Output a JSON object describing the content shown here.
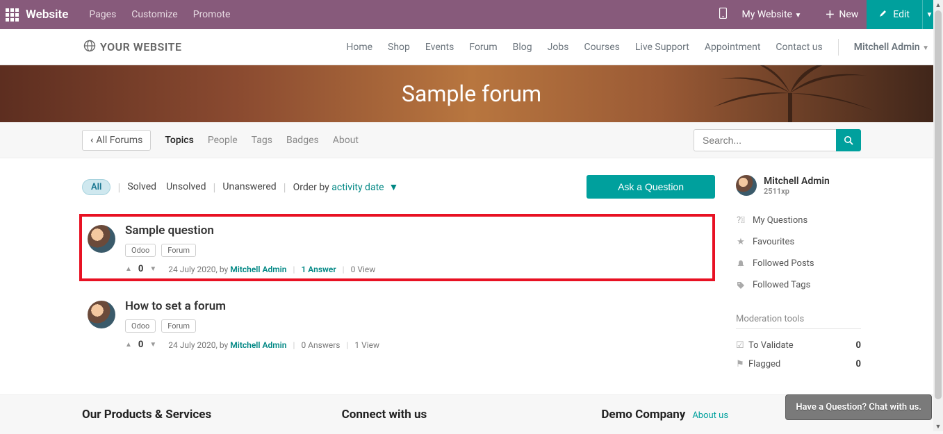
{
  "topbar": {
    "brand": "Website",
    "menu": [
      "Pages",
      "Customize",
      "Promote"
    ],
    "my_website": "My Website",
    "new": "New",
    "edit": "Edit"
  },
  "site": {
    "logo": "YOUR WEBSITE",
    "nav": [
      "Home",
      "Shop",
      "Events",
      "Forum",
      "Blog",
      "Jobs",
      "Courses",
      "Live Support",
      "Appointment",
      "Contact us"
    ],
    "user": "Mitchell Admin"
  },
  "hero": {
    "title": "Sample forum"
  },
  "forum_tabs": {
    "all_forums": "All Forums",
    "items": [
      "Topics",
      "People",
      "Tags",
      "Badges",
      "About"
    ],
    "search_placeholder": "Search..."
  },
  "filters": {
    "all": "All",
    "solved": "Solved",
    "unsolved": "Unsolved",
    "unanswered": "Unanswered",
    "order_by_label": "Order by",
    "order_by_value": "activity date",
    "ask": "Ask a Question"
  },
  "posts": [
    {
      "title": "Sample question",
      "tags": [
        "Odoo",
        "Forum"
      ],
      "votes": "0",
      "date": "24 July 2020",
      "by": "by",
      "author": "Mitchell Admin",
      "answers": "1 Answer",
      "views": "0 View",
      "highlighted": true
    },
    {
      "title": "How to set a forum",
      "tags": [
        "Odoo",
        "Forum"
      ],
      "votes": "0",
      "date": "24 July 2020",
      "by": "by",
      "author": "Mitchell Admin",
      "answers": "0 Answers",
      "views": "1 View",
      "highlighted": false
    }
  ],
  "sidebar": {
    "user_name": "Mitchell Admin",
    "user_xp": "2511xp",
    "links": [
      "My Questions",
      "Favourites",
      "Followed Posts",
      "Followed Tags"
    ],
    "mod_title": "Moderation tools",
    "mod": [
      {
        "label": "To Validate",
        "count": "0"
      },
      {
        "label": "Flagged",
        "count": "0"
      }
    ]
  },
  "footer": {
    "col1": "Our Products & Services",
    "col2": "Connect with us",
    "col3": "Demo Company",
    "about": "About us"
  },
  "chat": "Have a Question? Chat with us."
}
